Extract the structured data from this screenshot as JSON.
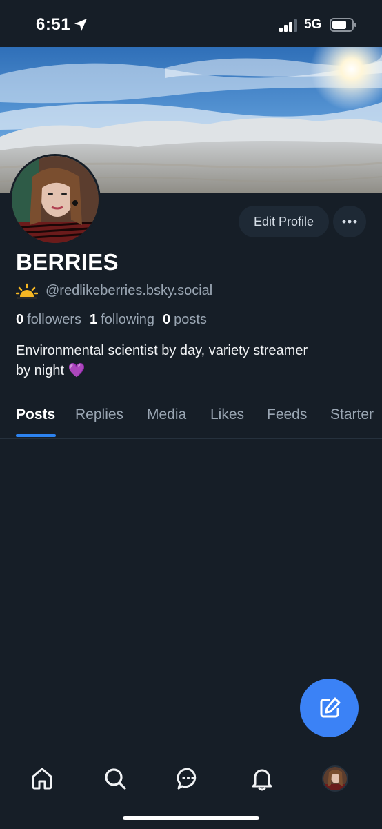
{
  "status_bar": {
    "time": "6:51",
    "network": "5G"
  },
  "profile": {
    "display_name": "BERRIES",
    "handle": "@redlikeberries.bsky.social",
    "followers_count": "0",
    "followers_label": "followers",
    "following_count": "1",
    "following_label": "following",
    "posts_count": "0",
    "posts_label": "posts",
    "bio_line1": "Environmental scientist by day, variety streamer",
    "bio_line2": "by night 💜"
  },
  "actions": {
    "edit_profile_label": "Edit Profile",
    "more_label": "•••"
  },
  "tabs": [
    {
      "label": "Posts",
      "active": true
    },
    {
      "label": "Replies"
    },
    {
      "label": "Media"
    },
    {
      "label": "Likes"
    },
    {
      "label": "Feeds"
    },
    {
      "label": "Starter"
    }
  ],
  "icons": {
    "compose": "compose-icon",
    "nav": [
      "home-icon",
      "search-icon",
      "chat-icon",
      "bell-icon",
      "avatar"
    ]
  },
  "colors": {
    "background": "#161e27",
    "accent": "#3b82f6",
    "muted_text": "#9aa6b3"
  }
}
